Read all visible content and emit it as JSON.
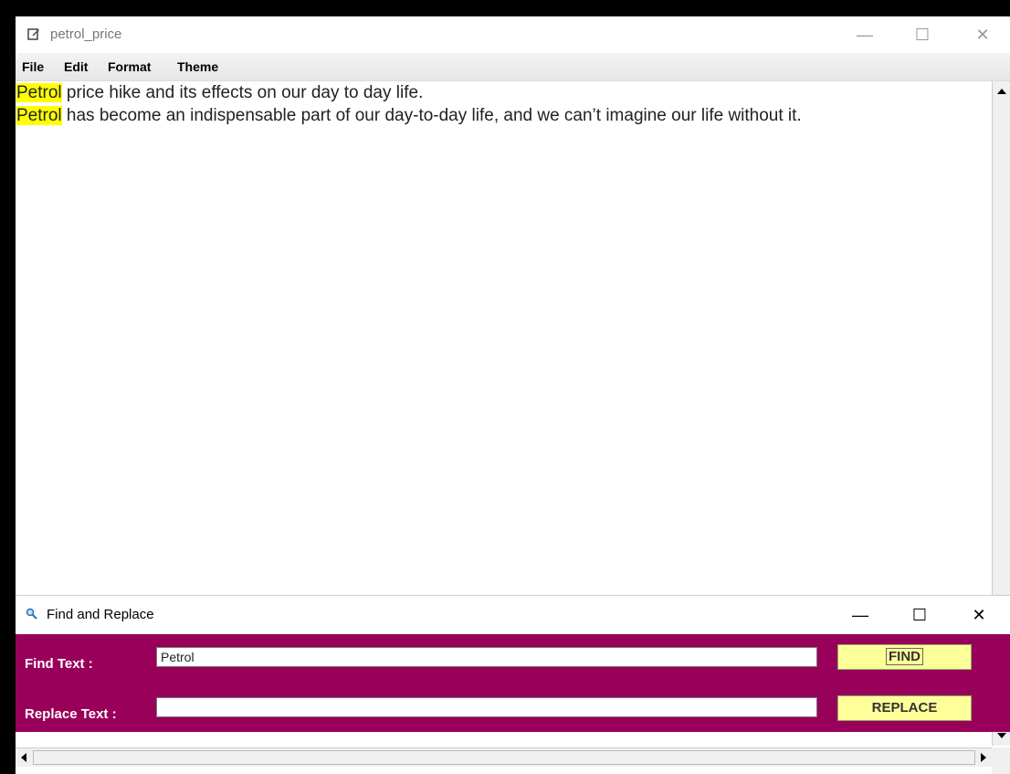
{
  "window": {
    "title": "petrol_price",
    "minimize": "—",
    "maximize": "☐",
    "close": "✕"
  },
  "menu": {
    "items": [
      "File",
      "Edit",
      "Format",
      "Theme"
    ]
  },
  "editor": {
    "lines": [
      {
        "highlight": "Petrol",
        "rest": " price hike and its effects on our day to day life."
      },
      {
        "highlight": "Petrol",
        "rest": " has become an indispensable part of our day-to-day life, and we can’t imagine our life without it."
      }
    ],
    "highlight_color": "#ffff00"
  },
  "dialog": {
    "title": "Find and Replace",
    "minimize": "—",
    "maximize": "☐",
    "close": "✕",
    "find_label": "Find Text :",
    "find_value": "Petrol",
    "replace_label": "Replace Text :",
    "replace_value": "",
    "find_button": "FIND",
    "replace_button": "REPLACE",
    "background_color": "#99005a",
    "button_color": "#ffff99"
  }
}
